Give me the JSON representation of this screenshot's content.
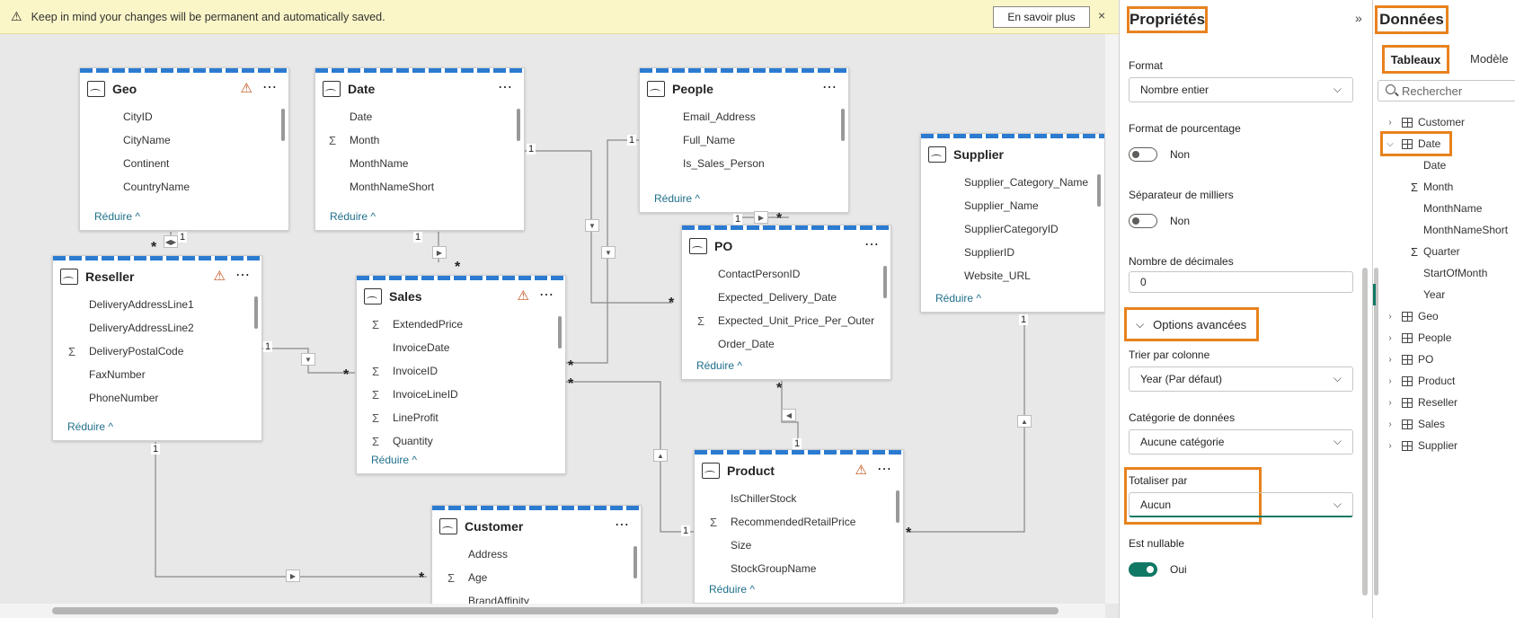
{
  "banner": {
    "message": "Keep in mind your changes will be permanent and automatically saved.",
    "learn_more": "En savoir plus",
    "close": "×"
  },
  "colors": {
    "accent_orange": "#e8821e",
    "teal": "#117865",
    "stripe_blue": "#2b7bd1",
    "warning": "#c0501a"
  },
  "tables": {
    "geo": {
      "name": "Geo",
      "fields": [
        {
          "s": "",
          "n": "CityID"
        },
        {
          "s": "",
          "n": "CityName"
        },
        {
          "s": "",
          "n": "Continent"
        },
        {
          "s": "",
          "n": "CountryName"
        }
      ],
      "reduce": "Réduire ^"
    },
    "date": {
      "name": "Date",
      "fields": [
        {
          "s": "",
          "n": "Date"
        },
        {
          "s": "Σ",
          "n": "Month"
        },
        {
          "s": "",
          "n": "MonthName"
        },
        {
          "s": "",
          "n": "MonthNameShort"
        }
      ],
      "reduce": "Réduire ^"
    },
    "people": {
      "name": "People",
      "fields": [
        {
          "s": "",
          "n": "Email_Address"
        },
        {
          "s": "",
          "n": "Full_Name"
        },
        {
          "s": "",
          "n": "Is_Sales_Person"
        }
      ],
      "reduce": "Réduire ^"
    },
    "supplier": {
      "name": "Supplier",
      "fields": [
        {
          "s": "",
          "n": "Supplier_Category_Name"
        },
        {
          "s": "",
          "n": "Supplier_Name"
        },
        {
          "s": "",
          "n": "SupplierCategoryID"
        },
        {
          "s": "",
          "n": "SupplierID"
        },
        {
          "s": "",
          "n": "Website_URL"
        }
      ],
      "reduce": "Réduire ^"
    },
    "reseller": {
      "name": "Reseller",
      "fields": [
        {
          "s": "",
          "n": "DeliveryAddressLine1"
        },
        {
          "s": "",
          "n": "DeliveryAddressLine2"
        },
        {
          "s": "Σ",
          "n": "DeliveryPostalCode"
        },
        {
          "s": "",
          "n": "FaxNumber"
        },
        {
          "s": "",
          "n": "PhoneNumber"
        }
      ],
      "reduce": "Réduire ^"
    },
    "sales": {
      "name": "Sales",
      "fields": [
        {
          "s": "Σ",
          "n": "ExtendedPrice"
        },
        {
          "s": "",
          "n": "InvoiceDate"
        },
        {
          "s": "Σ",
          "n": "InvoiceID"
        },
        {
          "s": "Σ",
          "n": "InvoiceLineID"
        },
        {
          "s": "Σ",
          "n": "LineProfit"
        },
        {
          "s": "Σ",
          "n": "Quantity"
        }
      ],
      "reduce": "Réduire ^"
    },
    "po": {
      "name": "PO",
      "fields": [
        {
          "s": "",
          "n": "ContactPersonID"
        },
        {
          "s": "",
          "n": "Expected_Delivery_Date"
        },
        {
          "s": "Σ",
          "n": "Expected_Unit_Price_Per_Outer"
        },
        {
          "s": "",
          "n": "Order_Date"
        }
      ],
      "reduce": "Réduire ^"
    },
    "product": {
      "name": "Product",
      "fields": [
        {
          "s": "",
          "n": "IsChillerStock"
        },
        {
          "s": "Σ",
          "n": "RecommendedRetailPrice"
        },
        {
          "s": "",
          "n": "Size"
        },
        {
          "s": "",
          "n": "StockGroupName"
        }
      ],
      "reduce": "Réduire ^"
    },
    "customer": {
      "name": "Customer",
      "fields": [
        {
          "s": "",
          "n": "Address"
        },
        {
          "s": "Σ",
          "n": "Age"
        },
        {
          "s": "",
          "n": "BrandAffinity"
        }
      ],
      "reduce": ""
    }
  },
  "rel": {
    "one": "1",
    "many": "*"
  },
  "properties": {
    "title": "Propriétés",
    "collapse": "»",
    "format_label": "Format",
    "format_value": "Nombre entier",
    "pct_label": "Format de pourcentage",
    "pct_value": "Non",
    "sep_label": "Séparateur de milliers",
    "sep_value": "Non",
    "dec_label": "Nombre de décimales",
    "dec_value": "0",
    "advanced": "Options avancées",
    "sort_label": "Trier par colonne",
    "sort_value": "Year (Par défaut)",
    "cat_label": "Catégorie de données",
    "cat_value": "Aucune catégorie",
    "sum_label": "Totaliser par",
    "sum_value": "Aucun",
    "null_label": "Est nullable",
    "null_value": "Oui"
  },
  "data_pane": {
    "title": "Données",
    "tab_tables": "Tableaux",
    "tab_model": "Modèle",
    "search_placeholder": "Rechercher",
    "tree": [
      {
        "label": "Customer",
        "type": "table",
        "expanded": false
      },
      {
        "label": "Date",
        "type": "table",
        "expanded": true
      },
      {
        "label": "Date",
        "type": "field",
        "sigma": false
      },
      {
        "label": "Month",
        "type": "field",
        "sigma": true
      },
      {
        "label": "MonthName",
        "type": "field",
        "sigma": false
      },
      {
        "label": "MonthNameShort",
        "type": "field",
        "sigma": false
      },
      {
        "label": "Quarter",
        "type": "field",
        "sigma": true
      },
      {
        "label": "StartOfMonth",
        "type": "field",
        "sigma": false
      },
      {
        "label": "Year",
        "type": "field",
        "sigma": false,
        "selected": true
      },
      {
        "label": "Geo",
        "type": "table",
        "expanded": false
      },
      {
        "label": "People",
        "type": "table",
        "expanded": false
      },
      {
        "label": "PO",
        "type": "table",
        "expanded": false
      },
      {
        "label": "Product",
        "type": "table",
        "expanded": false
      },
      {
        "label": "Reseller",
        "type": "table",
        "expanded": false
      },
      {
        "label": "Sales",
        "type": "table",
        "expanded": false
      },
      {
        "label": "Supplier",
        "type": "table",
        "expanded": false
      }
    ]
  }
}
